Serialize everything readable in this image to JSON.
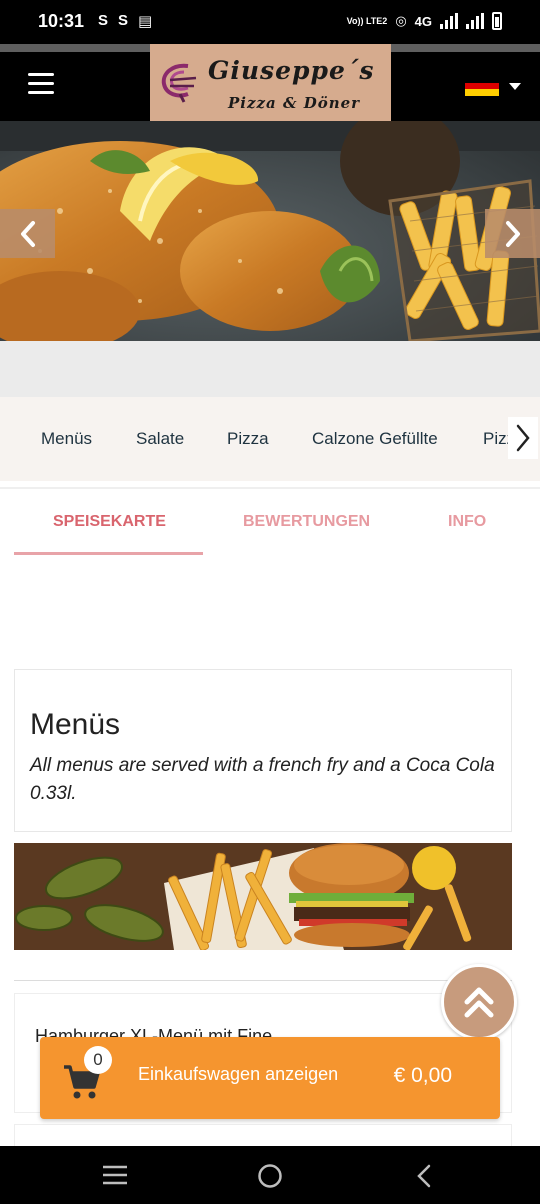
{
  "status_bar": {
    "time": "10:31",
    "network": "4G",
    "volte": "Vo)) LTE2"
  },
  "header": {
    "menu_icon": "hamburger-icon",
    "logo_name": "Giuseppe´s",
    "logo_sub": "Pizza & Döner",
    "language_flag": "germany-flag"
  },
  "categories": [
    "Menüs",
    "Salate",
    "Pizza",
    "Calzone Gefüllte",
    "Pizza"
  ],
  "tabs": [
    "SPEISEKARTE",
    "BEWERTUNGEN",
    "INFO"
  ],
  "section": {
    "title": "Menüs",
    "description": "All menus are served with a french fry and a Coca Cola 0.33l."
  },
  "products": [
    {
      "name": "Hamburger XL-Menü mit Fine"
    }
  ],
  "cart": {
    "count": "0",
    "label": "Einkaufswagen anzeigen",
    "total": "€ 0,00"
  },
  "colors": {
    "accent": "#f5952f",
    "logo_bg": "#d6ab8e",
    "tab_active": "#d9656e",
    "tab_inactive": "#e79aa0",
    "arrow_bg": "#b88c6a"
  }
}
